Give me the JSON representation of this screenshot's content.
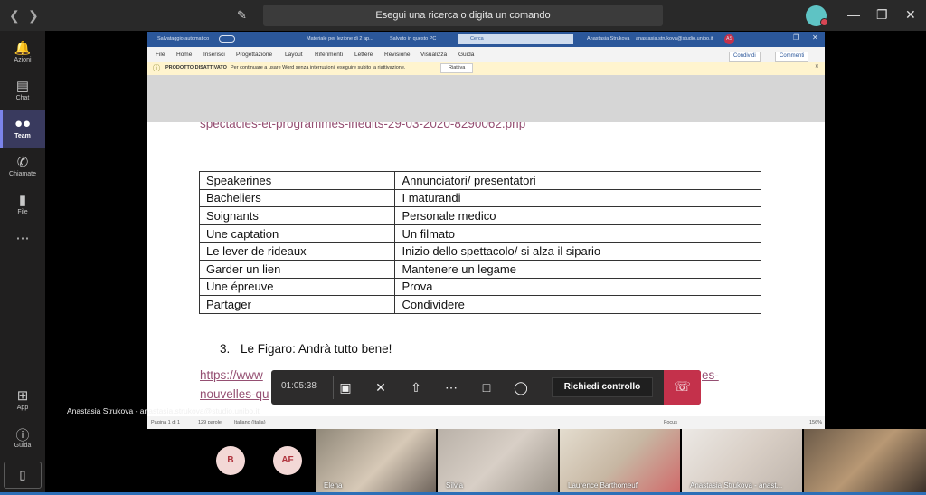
{
  "topbar": {
    "back_icon": "chevron-left-icon",
    "forward_icon": "chevron-right-icon",
    "compose_icon": "compose-icon",
    "search_placeholder": "Esegui una ricerca o digita un comando",
    "window_controls": [
      "minimize-icon",
      "maximize-icon",
      "close-icon"
    ]
  },
  "rail": {
    "items": [
      {
        "label": "Azioni",
        "icon": "bell-icon"
      },
      {
        "label": "Chat",
        "icon": "chat-icon"
      },
      {
        "label": "Team",
        "icon": "team-icon",
        "active": true
      },
      {
        "label": "Chiamate",
        "icon": "phone-icon"
      },
      {
        "label": "File",
        "icon": "file-icon"
      },
      {
        "label": "",
        "icon": "more-icon"
      }
    ],
    "bottom": [
      {
        "label": "App",
        "icon": "apps-icon"
      },
      {
        "label": "Guida",
        "icon": "help-icon"
      }
    ]
  },
  "word": {
    "autosave": "Salvataggio automatico",
    "doc_title": "Materiale per lezione di 2 ap...",
    "saved": "Salvato in questo PC",
    "search": "Cerca",
    "user": "Anastasia Strukova",
    "email": "anastasia.strukova@studio.unibo.it",
    "user_initials": "AS",
    "menu": [
      "File",
      "Home",
      "Inserisci",
      "Progettazione",
      "Layout",
      "Riferimenti",
      "Lettere",
      "Revisione",
      "Visualizza",
      "Guida"
    ],
    "share": "Condividi",
    "comments": "Commenti",
    "notice_title": "PRODOTTO DISATTIVATO",
    "notice_text": "Per continuare a usare Word senza interruzioni, eseguire subito la riattivazione.",
    "notice_action": "Riattiva",
    "link_top": "spectacles-et-programmes-inedits-29-03-2020-8290062.php",
    "table": [
      [
        "Speakerines",
        "Annunciatori/ presentatori"
      ],
      [
        "Bacheliers",
        "I maturandi"
      ],
      [
        "Soignants",
        "Personale medico"
      ],
      [
        "Une captation",
        "Un filmato"
      ],
      [
        "Le lever de rideaux",
        "Inizio dello spettacolo/ si alza il sipario"
      ],
      [
        "Garder un lien",
        "Mantenere un legame"
      ],
      [
        "Une épreuve",
        "Prova"
      ],
      [
        "Partager",
        "Condividere"
      ]
    ],
    "item3_number": "3.",
    "item3_text": "Le Figaro: Andrà tutto bene!",
    "link_bottom_1a": "https://www",
    "link_bottom_1b": "es-",
    "link_bottom_2": "nouvelles-qu",
    "status": {
      "page": "Pagina 1 di 1",
      "words": "129 parole",
      "lang": "Italiano (Italia)",
      "focus": "Focus",
      "zoom": "156%"
    }
  },
  "presenter": "Anastasia Strukova - anastasia.strukova@studio.unibo.it",
  "controls": {
    "timer": "01:05:38",
    "request_control": "Richiedi controllo",
    "icons": [
      "camera-icon",
      "mic-off-icon",
      "share-tray-icon",
      "more-icon",
      "chat-icon",
      "participants-icon",
      "hangup-icon"
    ]
  },
  "participants": {
    "avatars": [
      "B",
      "AF"
    ],
    "tiles": [
      "Elena",
      "Silvia",
      "Laurence Barthomeuf",
      "Anastasia Strukova - anast..."
    ]
  },
  "colors": {
    "accent": "#7b83eb",
    "word_blue": "#2b579a",
    "hangup": "#c4314b",
    "link": "#954f72"
  }
}
